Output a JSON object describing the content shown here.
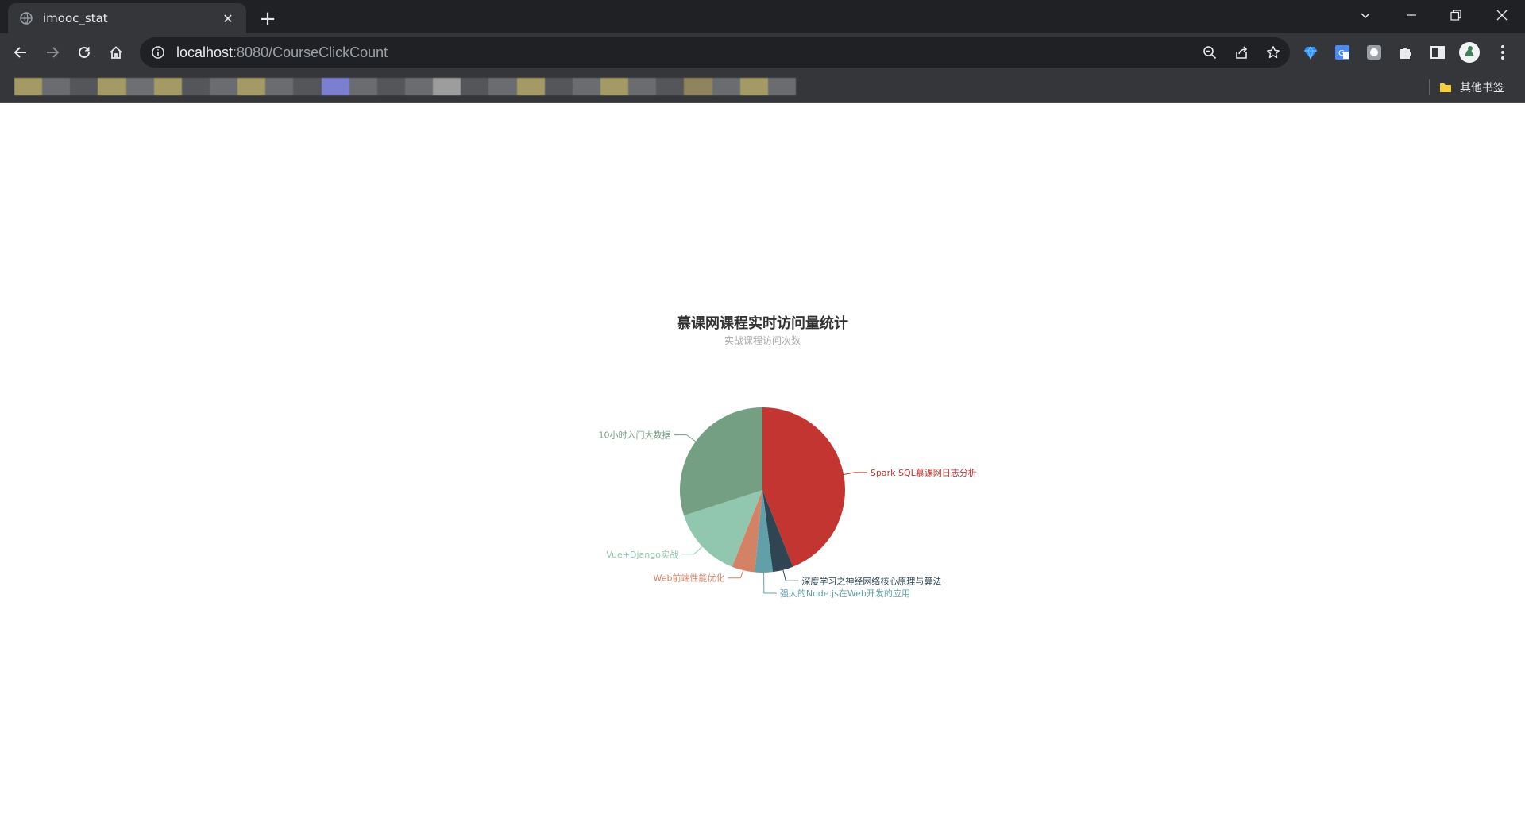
{
  "browser": {
    "tab": {
      "title": "imooc_stat",
      "close_label": "✕"
    },
    "new_tab_label": "+",
    "address": {
      "host": "localhost",
      "rest": ":8080/CourseClickCount"
    },
    "bookmarks": {
      "other_label": "其他书签",
      "blurred_colors": [
        "#a39a66",
        "#6b6c70",
        "#55565a",
        "#a39a66",
        "#6e6f73",
        "#a39a66",
        "#55565a",
        "#6b6c70",
        "#a39a66",
        "#6b6c70",
        "#55565a",
        "#7c7fd0",
        "#6b6c70",
        "#55565a",
        "#6b6c70",
        "#9d9d9d",
        "#55565a",
        "#6b6c70",
        "#a39a66",
        "#55565a",
        "#6b6c70",
        "#a39a66",
        "#6b6c70",
        "#55565a",
        "#8f845d",
        "#6b6c70",
        "#a39a66",
        "#6b6c70"
      ]
    }
  },
  "chart_data": {
    "type": "pie",
    "title": "慕课网课程实时访问量统计",
    "subtitle": "实战课程访问次数",
    "slices": [
      {
        "name": "Spark SQL慕课网日志分析",
        "value": 44,
        "color": "#c23531"
      },
      {
        "name": "深度学习之神经网络核心原理与算法",
        "value": 4,
        "color": "#2f4554"
      },
      {
        "name": "强大的Node.js在Web开发的应用",
        "value": 3.5,
        "color": "#61a0a8"
      },
      {
        "name": "Web前端性能优化",
        "value": 4.5,
        "color": "#d48265"
      },
      {
        "name": "Vue+Django实战",
        "value": 14,
        "color": "#91c7ae"
      },
      {
        "name": "10小时入门大数据",
        "value": 30,
        "color": "#749f83"
      }
    ]
  }
}
